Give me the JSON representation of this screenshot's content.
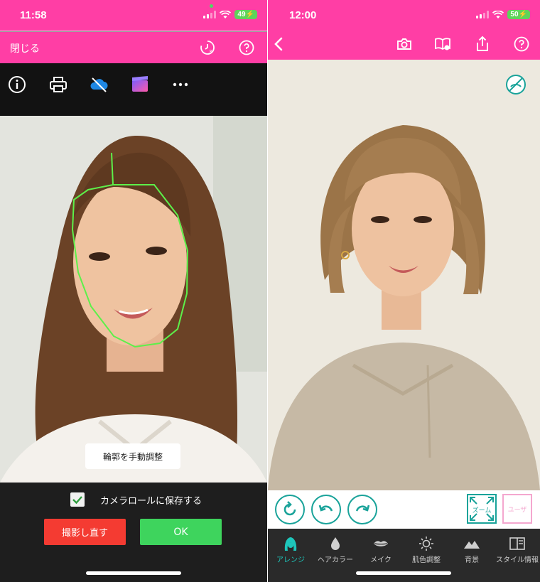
{
  "left_screen": {
    "status_time": "11:58",
    "battery": "49",
    "header": {
      "close_label": "閉じる"
    },
    "toolbar_icons": [
      "info-icon",
      "print-icon",
      "cloud-off-icon",
      "clapper-icon",
      "more-icon"
    ],
    "manual_contour_label": "輪郭を手動調整",
    "save_label": "カメラロールに保存する",
    "save_checked": true,
    "retake_label": "撮影し直す",
    "ok_label": "OK"
  },
  "right_screen": {
    "status_time": "12:00",
    "battery": "50",
    "header_icons": [
      "back-icon",
      "camera-icon",
      "book-icon",
      "share-icon",
      "help-icon"
    ],
    "zoom_label": "ズーム",
    "user_label": "ユーザ",
    "tabs": [
      {
        "label": "アレンジ",
        "icon": "hair-icon",
        "active": true
      },
      {
        "label": "ヘアカラー",
        "icon": "drop-icon",
        "active": false
      },
      {
        "label": "メイク",
        "icon": "lips-icon",
        "active": false
      },
      {
        "label": "肌色調整",
        "icon": "sun-icon",
        "active": false
      },
      {
        "label": "背景",
        "icon": "mountain-icon",
        "active": false
      },
      {
        "label": "スタイル情報",
        "icon": "book-icon",
        "active": false
      }
    ]
  },
  "colors": {
    "brand_pink": "#ff3ea5",
    "teal": "#1aa39a",
    "retake_red": "#f43b32",
    "ok_green": "#3ed45d",
    "contour_green": "#5df04a"
  }
}
